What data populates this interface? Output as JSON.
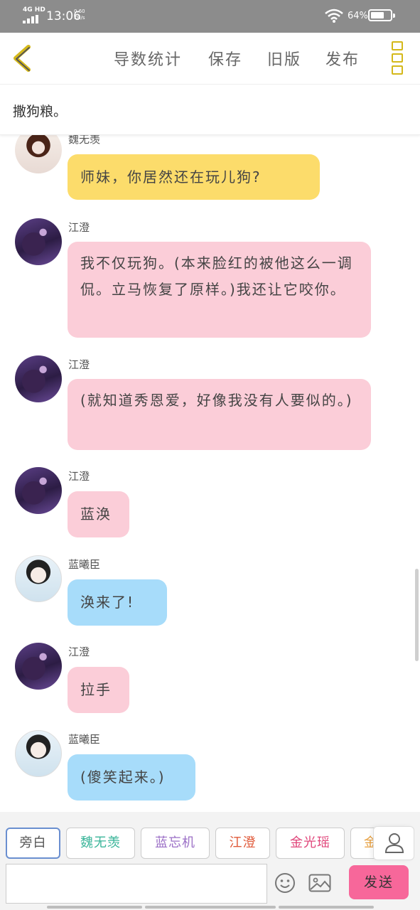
{
  "status_bar": {
    "network": "4G HD",
    "time": "13:06",
    "speed_value": "0.60",
    "speed_unit": "KB/s",
    "battery": "64%"
  },
  "nav": {
    "links": [
      "导数统计",
      "保存",
      "旧版",
      "发布"
    ]
  },
  "title": "撒狗粮。",
  "messages": [
    {
      "sender": "魏无羡",
      "text": "师妹，你居然还在玩儿狗?",
      "color": "yellow"
    },
    {
      "sender": "江澄",
      "text": "我不仅玩狗。(本来脸红的被他这么一调侃。立马恢复了原样。)我还让它咬你。",
      "color": "pink"
    },
    {
      "sender": "江澄",
      "text": "(就知道秀恩爱，好像我没有人要似的。)",
      "color": "pink"
    },
    {
      "sender": "江澄",
      "text": "蓝涣",
      "color": "pink"
    },
    {
      "sender": "蓝曦臣",
      "text": "涣来了!",
      "color": "blue"
    },
    {
      "sender": "江澄",
      "text": "拉手",
      "color": "pink"
    },
    {
      "sender": "蓝曦臣",
      "text": "(傻笑起来。)",
      "color": "blue"
    }
  ],
  "roles": [
    {
      "label": "旁白",
      "color": "#555555"
    },
    {
      "label": "魏无羡",
      "color": "#3bb59a"
    },
    {
      "label": "蓝忘机",
      "color": "#9b6fc6"
    },
    {
      "label": "江澄",
      "color": "#e05a3a"
    },
    {
      "label": "金光瑶",
      "color": "#e0457a"
    },
    {
      "label": "金",
      "color": "#e8a040"
    }
  ],
  "composer": {
    "placeholder": "",
    "send_label": "发送"
  },
  "colors": {
    "accent_pink": "#f7679a",
    "bubble_yellow": "#fcdc6b",
    "bubble_pink": "#fbcdd8",
    "bubble_blue": "#a7dcfa",
    "menu_yellow": "#d4b81a"
  }
}
